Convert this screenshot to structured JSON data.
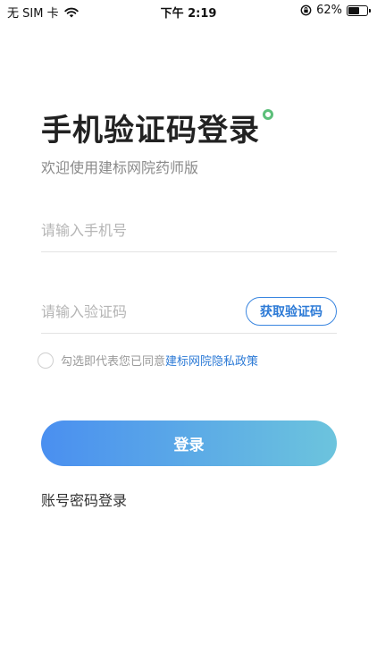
{
  "status_bar": {
    "carrier": "无 SIM 卡",
    "time": "下午 2:19",
    "battery_text": "62%",
    "battery_level": 0.62
  },
  "header": {
    "title": "手机验证码登录",
    "subtitle": "欢迎使用建标网院药师版",
    "dot_color": "#5cbf7a"
  },
  "form": {
    "phone_placeholder": "请输入手机号",
    "code_placeholder": "请输入验证码",
    "get_code_label": "获取验证码"
  },
  "agreement": {
    "checked": false,
    "text": "勾选即代表您已同意",
    "link": "建标网院隐私政策"
  },
  "login_button": "登录",
  "alt_login": "账号密码登录",
  "colors": {
    "accent": "#2c7ad6",
    "button_gradient_start": "#4a8ff0",
    "button_gradient_end": "#6cc4dd"
  }
}
